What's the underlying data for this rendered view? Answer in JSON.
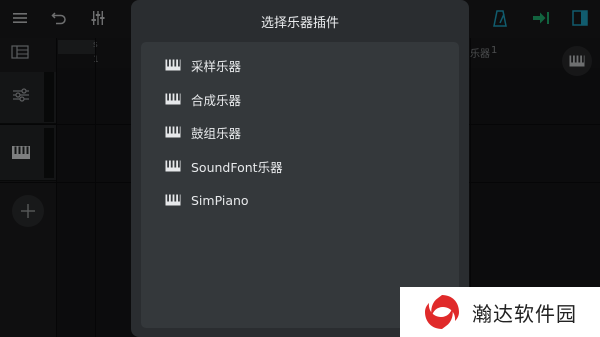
{
  "toolbar": {
    "icons": [
      "menu-icon",
      "undo-icon",
      "mixer-sliders-icon",
      "metronome-icon",
      "export-icon",
      "panel-toggle-icon"
    ],
    "accent": "#22b573",
    "panel_accent": "#20a8c8"
  },
  "background": {
    "ruler_fragment": "s",
    "ruler_mark": "1",
    "track_fragment": "乐器",
    "track_number": "1"
  },
  "dialog": {
    "title": "选择乐器插件",
    "items": [
      {
        "label": "采样乐器",
        "icon": "piano-keys-icon"
      },
      {
        "label": "合成乐器",
        "icon": "piano-keys-icon"
      },
      {
        "label": "鼓组乐器",
        "icon": "piano-keys-icon"
      },
      {
        "label": "SoundFont乐器",
        "icon": "piano-keys-icon"
      },
      {
        "label": "SimPiano",
        "icon": "piano-keys-icon"
      }
    ]
  },
  "watermark": {
    "text": "瀚达软件园",
    "logo": "swirl-logo",
    "logo_color": "#e02a2a"
  }
}
